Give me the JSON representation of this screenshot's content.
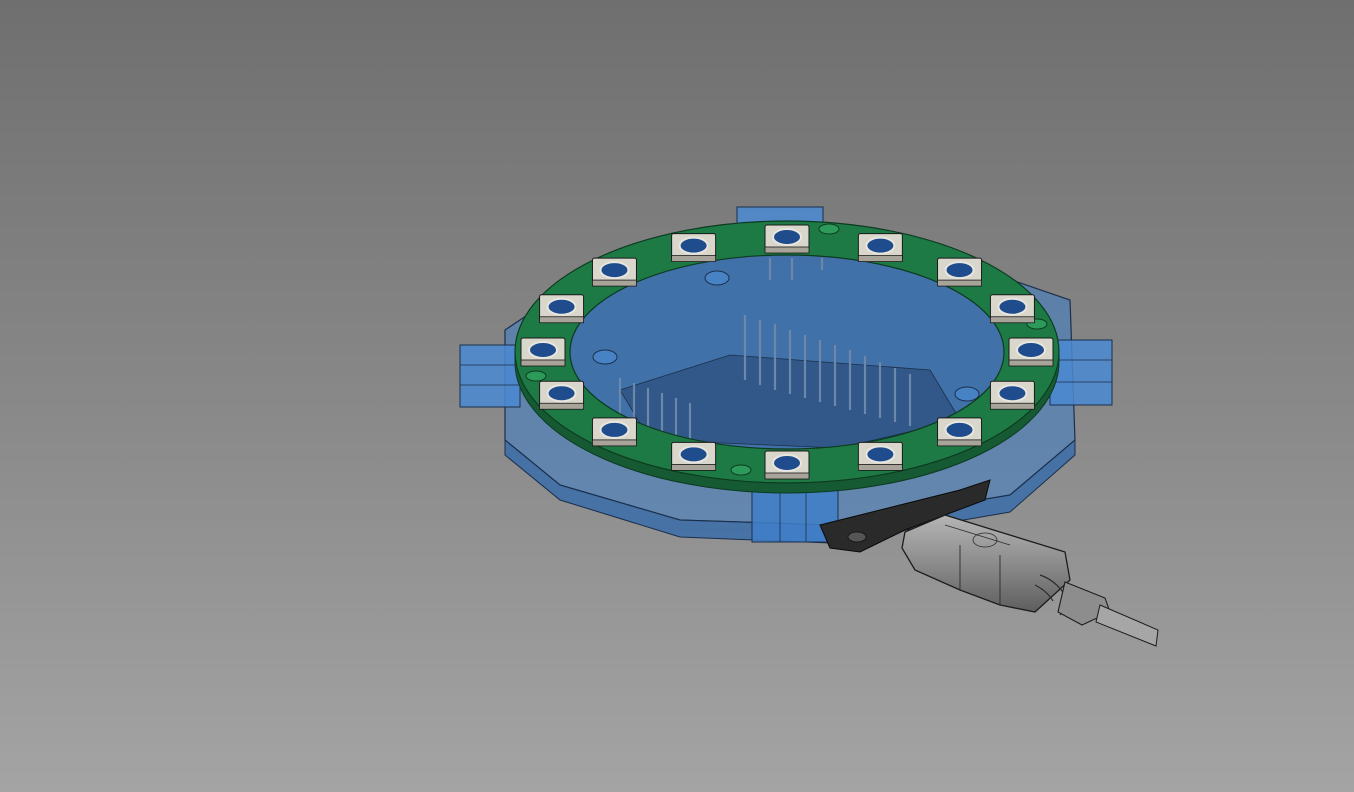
{
  "viewport": {
    "background_top": "#6f6f6f",
    "background_bottom": "#a4a4a4"
  },
  "model": {
    "icon": "3d-model-icon",
    "enclosure_color": "#3f7fc9",
    "pcb_ring_color": "#1d7a44",
    "led_count": 16,
    "led_lens_color": "#1f4c8c",
    "led_body_color": "#d9d6cc",
    "cable_color": "#8e8e8e",
    "board_color": "#2a2a2a"
  }
}
